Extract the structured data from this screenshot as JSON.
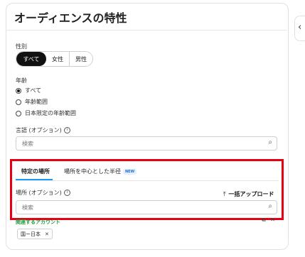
{
  "title": "オーディエンスの特性",
  "gender": {
    "label": "性別",
    "options": [
      "すべて",
      "女性",
      "男性"
    ],
    "selected": "すべて"
  },
  "age": {
    "label": "年齢",
    "options": [
      "すべて",
      "年齢範囲",
      "日本限定の年齢範囲"
    ],
    "selected": "すべて"
  },
  "language": {
    "label": "言語 (オプション)",
    "placeholder": "検索"
  },
  "location": {
    "tabs": [
      {
        "label": "特定の場所",
        "active": true
      },
      {
        "label": "場所を中心とした半径",
        "badge": "NEW",
        "active": false
      }
    ],
    "label": "場所 (オプション)",
    "bulk_upload": "一括アップロード",
    "placeholder": "検索"
  },
  "related_accounts": {
    "label": "関連するアカウント",
    "chip": "国ー日本"
  },
  "colors": {
    "highlight_border": "#e60012",
    "tab_accent": "#1d9bf0",
    "related_label": "#1a9e3f",
    "selected_segment": "#111111"
  }
}
